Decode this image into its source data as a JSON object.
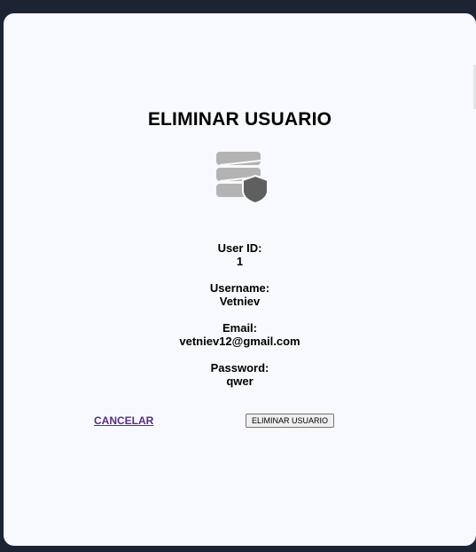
{
  "dialog": {
    "title": "ELIMINAR USUARIO",
    "icon": "database-shield-icon"
  },
  "fields": [
    {
      "label": "User ID:",
      "value": "1"
    },
    {
      "label": "Username:",
      "value": "Vetniev"
    },
    {
      "label": "Email:",
      "value": "vetniev12@gmail.com"
    },
    {
      "label": "Password:",
      "value": "qwer"
    }
  ],
  "actions": {
    "cancel_label": "CANCELAR",
    "delete_label": "ELIMINAR USUARIO"
  },
  "colors": {
    "background": "#1c2333",
    "card": "#f8f9fe",
    "link": "#5b2a86",
    "icon_gray": "#b3b3b3",
    "shield_gray": "#5f5f5f"
  }
}
